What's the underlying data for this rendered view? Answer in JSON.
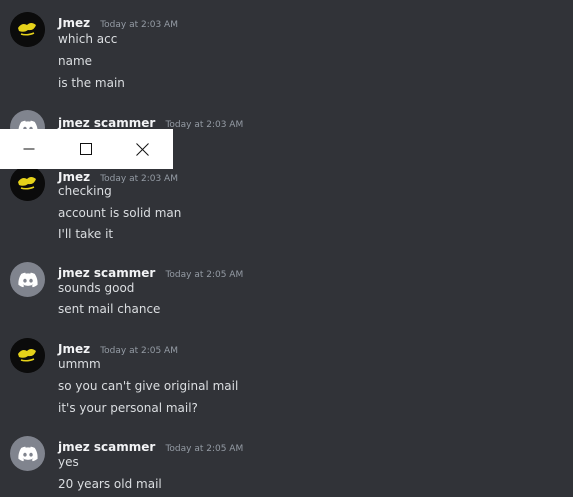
{
  "colors": {
    "background": "#313338",
    "username": "#f2f3f5",
    "timestamp": "#949ba4",
    "text": "#dbdee1",
    "discord_avatar": "#80848e",
    "jmez_avatar_accent": "#e6d21a"
  },
  "messages": [
    {
      "author": "Jmez",
      "avatar": "jmez-logo-avatar",
      "timestamp": "Today at 2:03 AM",
      "lines": [
        "which acc",
        "name",
        "is the main"
      ]
    },
    {
      "author": "jmez scammer",
      "avatar": "discord-default-avatar",
      "timestamp": "Today at 2:03 AM",
      "lines": []
    },
    {
      "author": "Jmez",
      "avatar": "jmez-logo-avatar",
      "timestamp": "Today at 2:03 AM",
      "lines": [
        "checking",
        "account is solid man",
        "I'll take it"
      ]
    },
    {
      "author": "jmez scammer",
      "avatar": "discord-default-avatar",
      "timestamp": "Today at 2:05 AM",
      "lines": [
        "sounds good",
        "sent mail chance"
      ]
    },
    {
      "author": "Jmez",
      "avatar": "jmez-logo-avatar",
      "timestamp": "Today at 2:05 AM",
      "lines": [
        "ummm",
        "so you can't give original mail",
        "it's your personal mail?"
      ]
    },
    {
      "author": "jmez scammer",
      "avatar": "discord-default-avatar",
      "timestamp": "Today at 2:05 AM",
      "lines": [
        "yes",
        "20 years old mail"
      ]
    }
  ],
  "window_controls": {
    "icons": [
      "minimize-icon",
      "maximize-icon",
      "close-icon"
    ]
  }
}
